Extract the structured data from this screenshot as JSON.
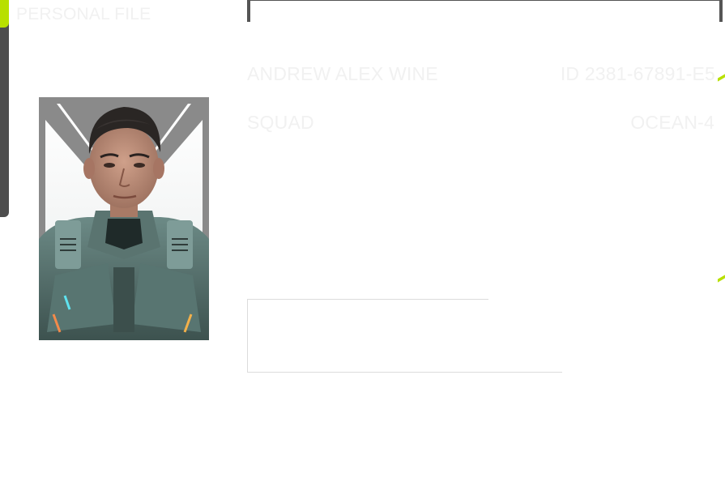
{
  "header": {
    "title": "PERSONAL FILE"
  },
  "profile": {
    "name": "ANDREW ALEX WINE",
    "id": "ID 2381-67891-E5",
    "squad_label": "SQUAD",
    "squad_value": "OCEAN-4"
  },
  "portrait": {
    "icon": "person-portrait-icon"
  },
  "colors": {
    "accent": "#b8e000",
    "frame": "#555555",
    "text": "#f1f1f1",
    "portrait_frame": "#8a8a8a"
  }
}
